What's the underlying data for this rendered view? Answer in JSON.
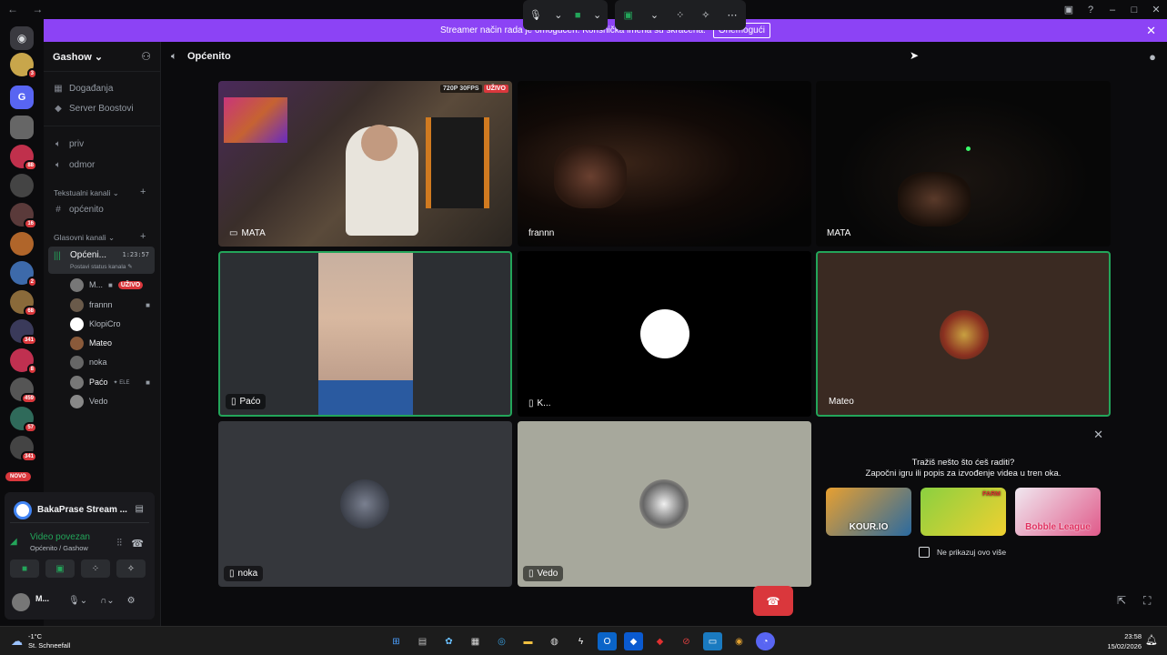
{
  "window": {
    "title": "Gashow",
    "nav_icons": [
      "back-arrow-icon",
      "forward-arrow-icon"
    ],
    "controls": [
      "minimize-icon",
      "maximize-icon",
      "close-icon"
    ]
  },
  "banner": {
    "text": "Streamer način rada je omogućen. Korisnička imena su skraćena.",
    "button": "Onemogući",
    "bg_color": "#8c43f5"
  },
  "guild_rail": {
    "badges": [
      "3",
      "",
      "",
      "88",
      "",
      "16",
      "",
      "2",
      "68",
      "341",
      "8",
      "459",
      "57",
      "341"
    ],
    "new_label": "NOVO"
  },
  "sidebar": {
    "server_name": "Gashow",
    "top_items": [
      {
        "icon": "calendar-icon",
        "label": "Događanja"
      },
      {
        "icon": "boost-icon",
        "label": "Server Boostovi"
      }
    ],
    "voice_channels_top": [
      {
        "icon": "speaker-icon",
        "label": "priv"
      },
      {
        "icon": "speaker-icon",
        "label": "odmor"
      }
    ],
    "text_category": "Tekstualni kanali",
    "text_channels": [
      {
        "icon": "hash-icon",
        "label": "općenito"
      }
    ],
    "voice_category": "Glasovni kanali",
    "active_channel": {
      "name": "Općeni...",
      "time": "1:23:57",
      "status": "Postavi status kanala"
    },
    "voice_users": [
      {
        "name": "M...",
        "live": "UŽIVO",
        "camera": true
      },
      {
        "name": "frannn",
        "live": "",
        "camera": true
      },
      {
        "name": "KlopiCro",
        "live": "",
        "camera": false
      },
      {
        "name": "Mateo",
        "live": "",
        "camera": false
      },
      {
        "name": "noka",
        "live": "",
        "camera": false
      },
      {
        "name": "Paćo",
        "live": "",
        "camera": true,
        "extra": "ELE"
      },
      {
        "name": "Vedo",
        "live": "",
        "camera": false
      }
    ]
  },
  "rtc_panel": {
    "activity": "BakaPrase Stream ...",
    "connection": "Video povezan",
    "channel_path": "Općenito / Gashow",
    "buttons": [
      "camera-icon",
      "screen-share-icon",
      "activities-icon",
      "soundboard-icon"
    ],
    "user_name": "M..."
  },
  "header": {
    "channel_title": "Općenito"
  },
  "tiles": [
    {
      "label": "MATA",
      "label_icon": "screen-icon",
      "quality": "720P 30FPS",
      "live": "UŽIVO"
    },
    {
      "label": "frannn"
    },
    {
      "label": "MATA"
    },
    {
      "label": "Paćo",
      "label_icon": "phone-icon"
    },
    {
      "label": "K...",
      "label_icon": "phone-icon"
    },
    {
      "label": "Mateo"
    },
    {
      "label": "noka",
      "label_icon": "phone-icon"
    },
    {
      "label": "Vedo",
      "label_icon": "phone-icon"
    }
  ],
  "promo": {
    "line1": "Tražiš nešto što ćeš raditi?",
    "line2": "Započni igru ili popis za izvođenje videa u tren oka.",
    "games": [
      "KOUR.IO",
      "FARM",
      "Bobble League"
    ],
    "checkbox": "Ne prikazuj ovo više"
  },
  "taskbar": {
    "temp": "-1°C",
    "weather": "St. Schneefall",
    "time": "23:58",
    "date": "15/02/2026"
  },
  "colors": {
    "accent_green": "#23a55a",
    "live_red": "#da373c",
    "banner_purple": "#8c43f5"
  }
}
